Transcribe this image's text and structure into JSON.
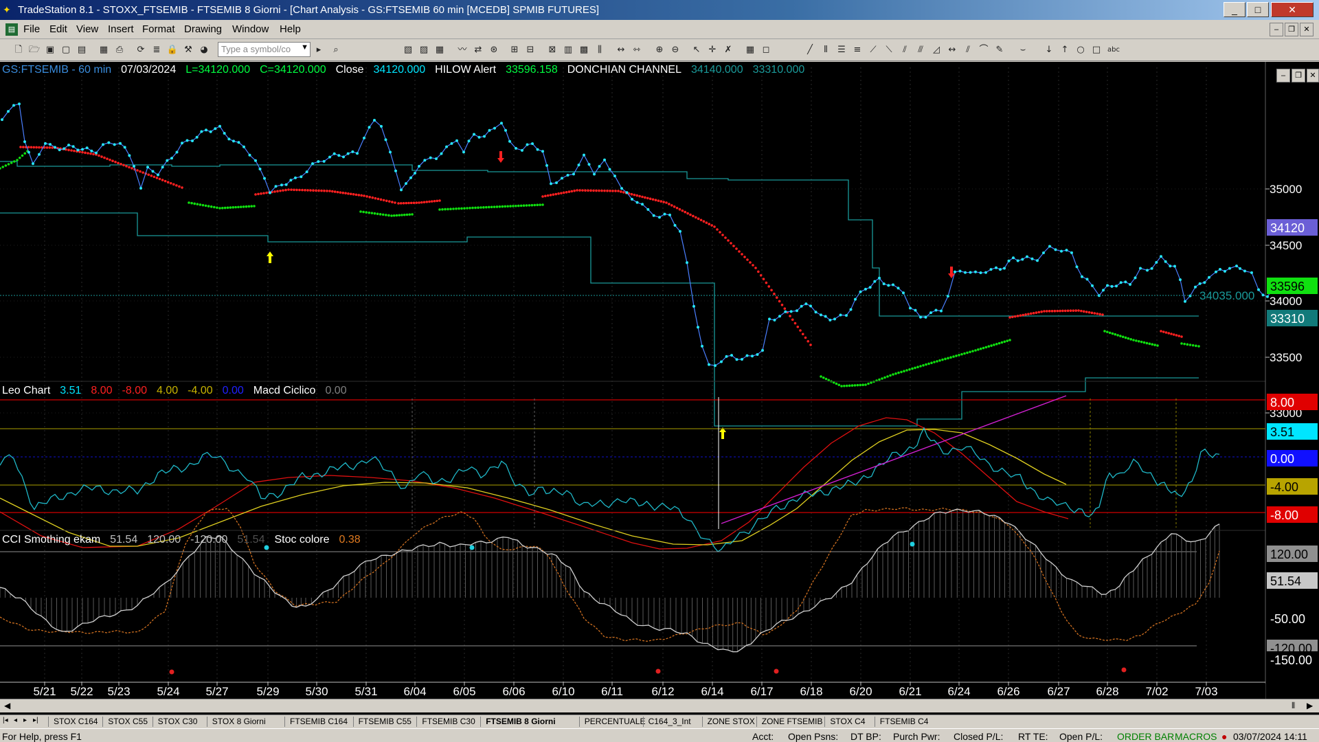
{
  "window": {
    "title": "TradeStation 8.1 - STOXX_FTSEMIB - FTSEMIB  8 Giorni - [Chart Analysis - GS:FTSEMIB  60 min  [MCEDB] SPMIB FUTURES]",
    "minimize": "_",
    "maximize": "□",
    "close": "✕"
  },
  "menu": [
    "File",
    "Edit",
    "View",
    "Insert",
    "Format",
    "Drawing",
    "Window",
    "Help"
  ],
  "toolbar": {
    "symbol_placeholder": "Type a symbol/co"
  },
  "price_panel": {
    "header": [
      {
        "text": "GS:FTSEMIB - 60 min",
        "color": "#3a8dde"
      },
      {
        "text": "07/03/2024",
        "color": "#ffffff"
      },
      {
        "text": "L=34120.000",
        "color": "#00ff40"
      },
      {
        "text": "C=34120.000",
        "color": "#00ff40"
      },
      {
        "text": "Close",
        "color": "#ffffff"
      },
      {
        "text": "34120.000",
        "color": "#00e5ff"
      },
      {
        "text": "HILOW Alert",
        "color": "#ffffff"
      },
      {
        "text": "33596.158",
        "color": "#00ff40"
      },
      {
        "text": "DONCHIAN CHANNEL",
        "color": "#ffffff"
      },
      {
        "text": "34140.000",
        "color": "#1a9a9a"
      },
      {
        "text": "33310.000",
        "color": "#1a9a9a"
      }
    ],
    "axis_ticks": [
      "35000",
      "34500",
      "34000",
      "33500",
      "33000"
    ],
    "last_price_label": "34035.000",
    "badges": [
      {
        "text": "34120",
        "bg": "#6b5fd6",
        "fg": "#ffffff"
      },
      {
        "text": "33596",
        "bg": "#10e010",
        "fg": "#000000"
      },
      {
        "text": "33310",
        "bg": "#127a7a",
        "fg": "#ffffff"
      }
    ]
  },
  "leo_panel": {
    "header": [
      {
        "text": "Leo Chart",
        "color": "#ffffff"
      },
      {
        "text": "3.51",
        "color": "#00e5ff"
      },
      {
        "text": "8.00",
        "color": "#ff2020"
      },
      {
        "text": "-8.00",
        "color": "#ff2020"
      },
      {
        "text": "4.00",
        "color": "#c8b400"
      },
      {
        "text": "-4.00",
        "color": "#c8b400"
      },
      {
        "text": "0.00",
        "color": "#2020ff"
      },
      {
        "text": "Macd Ciclico",
        "color": "#ffffff"
      },
      {
        "text": "0.00",
        "color": "#808080"
      }
    ],
    "badges": [
      {
        "text": "8.00",
        "bg": "#e00000",
        "fg": "#ffffff"
      },
      {
        "text": "3.51",
        "bg": "#00e5ff",
        "fg": "#000000"
      },
      {
        "text": "0.00",
        "bg": "#1010ff",
        "fg": "#ffffff"
      },
      {
        "text": "-4.00",
        "bg": "#b8a400",
        "fg": "#000000"
      },
      {
        "text": "-8.00",
        "bg": "#e00000",
        "fg": "#ffffff"
      }
    ]
  },
  "cci_panel": {
    "header": [
      {
        "text": "CCI Smothing ekam",
        "color": "#ffffff"
      },
      {
        "text": "51.54",
        "color": "#c0c0c0"
      },
      {
        "text": "120.00",
        "color": "#c0c0c0"
      },
      {
        "text": "-120.00",
        "color": "#c0c0c0"
      },
      {
        "text": "51.54",
        "color": "#505050"
      },
      {
        "text": "Stoc colore",
        "color": "#ffffff"
      },
      {
        "text": "0.38",
        "color": "#e07a20"
      }
    ],
    "badges": [
      {
        "text": "120.00",
        "bg": "#909090",
        "fg": "#000000"
      },
      {
        "text": "51.54",
        "bg": "#c8c8c8",
        "fg": "#000000"
      },
      {
        "text": "-50.00",
        "bg": "#000000",
        "fg": "#ffffff"
      },
      {
        "text": "-120.00",
        "bg": "#909090",
        "fg": "#000000"
      },
      {
        "text": "-150.00",
        "bg": "#000000",
        "fg": "#ffffff"
      }
    ]
  },
  "date_axis": [
    "5/21",
    "5/22",
    "5/23",
    "5/24",
    "5/27",
    "5/29",
    "5/30",
    "5/31",
    "6/04",
    "6/05",
    "6/06",
    "6/10",
    "6/11",
    "6/12",
    "6/14",
    "6/17",
    "6/18",
    "6/20",
    "6/21",
    "6/24",
    "6/26",
    "6/27",
    "6/28",
    "7/02",
    "7/03"
  ],
  "tabs": [
    {
      "label": "STOX C164",
      "active": false
    },
    {
      "label": "STOX C55",
      "active": false
    },
    {
      "label": "STOX  C30",
      "active": false
    },
    {
      "label": "STOX  8 Giorni",
      "active": false
    },
    {
      "label": "FTSEMIB C164",
      "active": false
    },
    {
      "label": "FTSEMIB C55",
      "active": false
    },
    {
      "label": "FTSEMIB C30",
      "active": false
    },
    {
      "label": "FTSEMIB  8 Giorni",
      "active": true
    },
    {
      "label": "PERCENTUALE",
      "active": false
    },
    {
      "label": "C164_3_Int",
      "active": false
    },
    {
      "label": "ZONE STOX",
      "active": false
    },
    {
      "label": "ZONE FTSEMIB",
      "active": false
    },
    {
      "label": "STOX  C4",
      "active": false
    },
    {
      "label": "FTSEMIB C4",
      "active": false
    }
  ],
  "status": {
    "help": "For Help, press F1",
    "acct": "Acct:",
    "open_psns": "Open Psns:",
    "dt_bp": "DT BP:",
    "purch_pwr": "Purch Pwr:",
    "closed_pl": "Closed P/L:",
    "rt_te": "RT TE:",
    "open_pl": "Open P/L:",
    "order_bar": "ORDER BAR",
    "macros": "MACROS",
    "datetime": "03/07/2024 14:11"
  }
}
